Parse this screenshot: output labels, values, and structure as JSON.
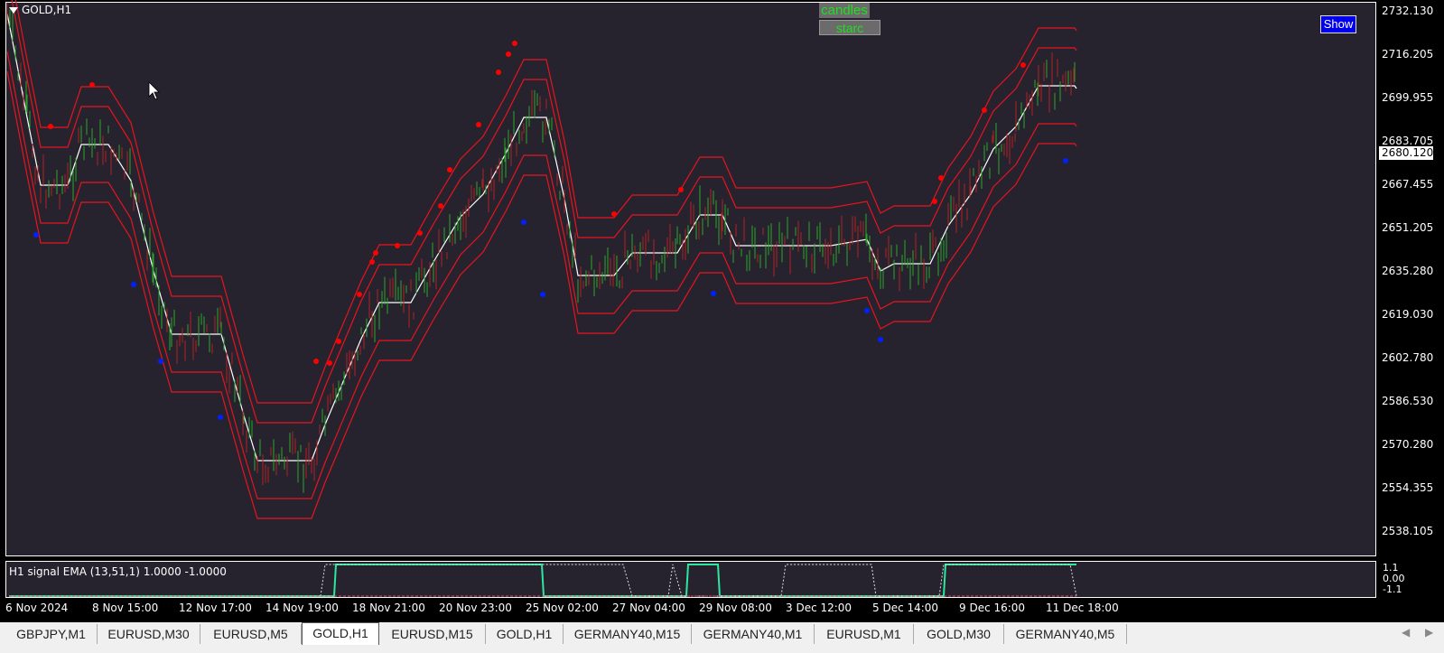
{
  "chart": {
    "symbol_title": "GOLD,H1",
    "buttons": {
      "candles": "candles",
      "starc": "starc",
      "show": "Show"
    },
    "price_labels": [
      "2732.130",
      "2716.205",
      "2699.955",
      "2683.705",
      "2667.455",
      "2651.205",
      "2635.280",
      "2619.030",
      "2602.780",
      "2586.530",
      "2570.280",
      "2554.355",
      "2538.105"
    ],
    "current_price": "2680.120",
    "time_labels": [
      "6 Nov 2024",
      "8 Nov 15:00",
      "12 Nov 17:00",
      "14 Nov 19:00",
      "18 Nov 21:00",
      "20 Nov 23:00",
      "25 Nov 02:00",
      "27 Nov 04:00",
      "29 Nov 08:00",
      "3 Dec 12:00",
      "5 Dec 14:00",
      "9 Dec 16:00",
      "11 Dec 18:00"
    ],
    "colors": {
      "background": "#26232f",
      "band": "#e8141e",
      "middle": "#ffffff",
      "bull": "#2aa52a",
      "bear": "#b02020",
      "dot_red": "#ff0000",
      "dot_blue": "#0020ff",
      "signal_up": "#2ee6a0",
      "signal_down": "#ff4060"
    }
  },
  "indicator": {
    "label": "H1 signal EMA (13,51,1) 1.0000 -1.0000",
    "scale": [
      "1.1",
      "0.00",
      "-1.1"
    ]
  },
  "tabs": [
    {
      "label": "GBPJPY,M1",
      "active": false
    },
    {
      "label": "EURUSD,M30",
      "active": false
    },
    {
      "label": "EURUSD,M5",
      "active": false
    },
    {
      "label": "GOLD,H1",
      "active": true
    },
    {
      "label": "EURUSD,M15",
      "active": false
    },
    {
      "label": "GOLD,H1",
      "active": false
    },
    {
      "label": "GERMANY40,M15",
      "active": false
    },
    {
      "label": "GERMANY40,M1",
      "active": false
    },
    {
      "label": "EURUSD,M1",
      "active": false
    },
    {
      "label": "GOLD,M30",
      "active": false
    },
    {
      "label": "GERMANY40,M5",
      "active": false
    }
  ]
}
